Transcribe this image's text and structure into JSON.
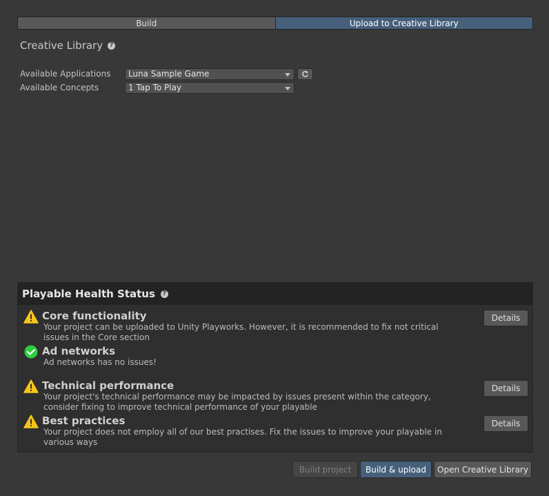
{
  "tabs": [
    {
      "label": "Build",
      "active": false
    },
    {
      "label": "Upload to Creative Library",
      "active": true
    }
  ],
  "section": {
    "title": "Creative Library",
    "help_icon": "question-circle-icon"
  },
  "fields": {
    "applications": {
      "label": "Available Applications",
      "value": "Luna Sample Game",
      "refresh_icon": "refresh-icon"
    },
    "concepts": {
      "label": "Available Concepts",
      "value": "1 Tap To Play"
    }
  },
  "health": {
    "title": "Playable Health Status",
    "items": [
      {
        "status": "warning",
        "icon": "warning-icon",
        "title": "Core functionality",
        "desc": "Your project can be uploaded to Unity Playworks. However, it is recommended to fix not critical issues in the Core section",
        "details_label": "Details"
      },
      {
        "status": "ok",
        "icon": "check-icon",
        "title": "Ad networks",
        "desc": "Ad networks has no issues!"
      },
      {
        "status": "warning",
        "icon": "warning-icon",
        "title": "Technical performance",
        "desc": "Your project's technical performance may be impacted by issues present within the category, consider fixing to improve technical performance of your playable",
        "details_label": "Details"
      },
      {
        "status": "warning",
        "icon": "warning-icon",
        "title": "Best practices",
        "desc": "Your project does not employ all of our best practises. Fix the issues to improve your playable in various ways",
        "details_label": "Details"
      }
    ]
  },
  "footer": {
    "build_project": "Build project",
    "build_upload": "Build & upload",
    "open_library": "Open Creative Library"
  },
  "colors": {
    "background": "#383838",
    "accent": "#46607c",
    "warning": "#f5c518",
    "ok": "#2ecc40"
  }
}
